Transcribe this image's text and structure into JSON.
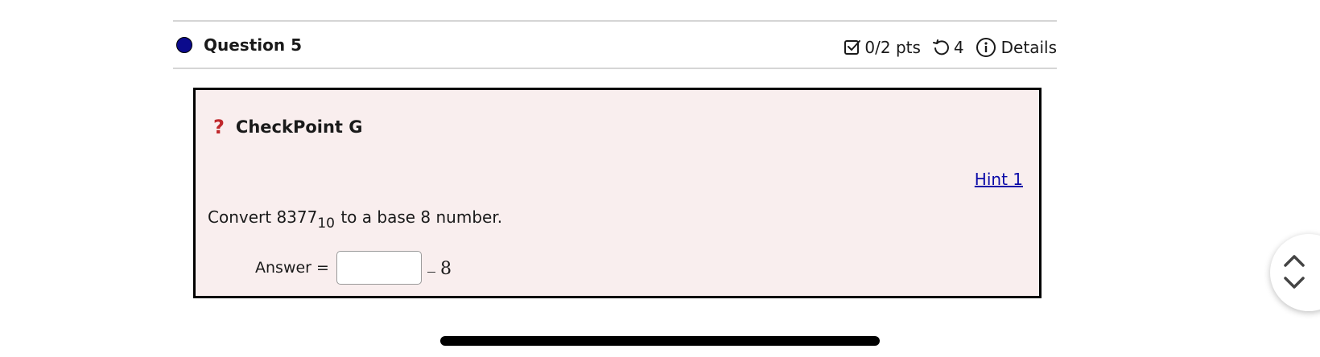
{
  "question": {
    "title": "Question 5",
    "status_color": "#0b0a8c",
    "points": "0/2 pts",
    "attempts": "4",
    "details_label": "Details",
    "icons": {
      "points": "checkbox-icon",
      "attempts": "retry-icon",
      "details": "info-icon"
    }
  },
  "panel": {
    "title": "CheckPoint G",
    "title_icon": "question-mark-icon",
    "hint_label": "Hint 1",
    "prompt_prefix": "Convert 8377",
    "prompt_base": "10",
    "prompt_suffix": " to a base 8 number.",
    "answer_label": "Answer =",
    "answer_value": "",
    "answer_base": "8"
  },
  "colors": {
    "panel_background": "#f9eeee",
    "link": "#0b0aa8",
    "accent_red": "#c0282c"
  },
  "navigation": {
    "up_icon": "chevron-up-icon",
    "down_icon": "chevron-down-icon"
  }
}
